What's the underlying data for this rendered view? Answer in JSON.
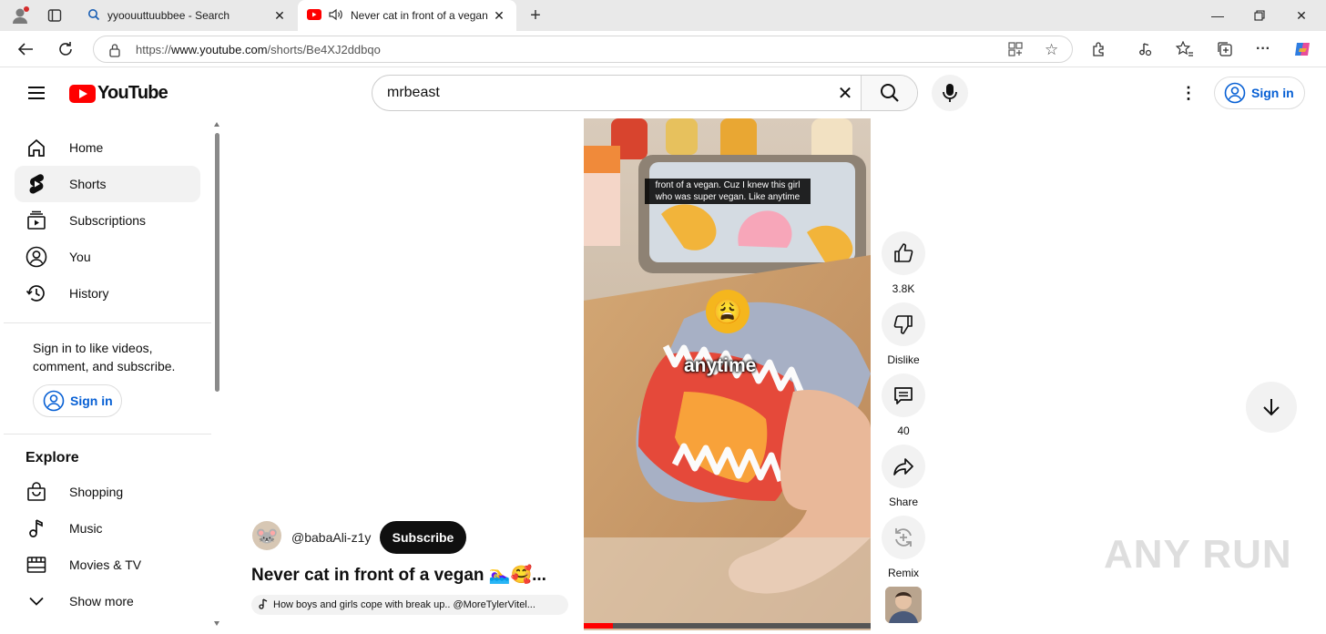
{
  "browser": {
    "tabs": [
      {
        "title": "yyoouuttuubbee - Search",
        "active": false
      },
      {
        "title": "Never cat in front of a vegan",
        "active": true
      }
    ],
    "url_prefix": "https://",
    "url_domain": "www.youtube.com",
    "url_path": "/shorts/Be4XJ2ddbqo"
  },
  "header": {
    "logo_text": "YouTube",
    "search_value": "mrbeast",
    "signin_label": "Sign in"
  },
  "sidebar": {
    "items": [
      {
        "label": "Home",
        "icon": "home-icon"
      },
      {
        "label": "Shorts",
        "icon": "shorts-icon",
        "selected": true
      },
      {
        "label": "Subscriptions",
        "icon": "subscriptions-icon"
      },
      {
        "label": "You",
        "icon": "you-icon"
      },
      {
        "label": "History",
        "icon": "history-icon"
      }
    ],
    "signin_message": "Sign in to like videos, comment, and subscribe.",
    "signin_label": "Sign in",
    "explore_heading": "Explore",
    "explore_items": [
      {
        "label": "Shopping",
        "icon": "shopping-icon"
      },
      {
        "label": "Music",
        "icon": "music-icon"
      },
      {
        "label": "Movies & TV",
        "icon": "movies-icon"
      },
      {
        "label": "Show more",
        "icon": "chevron-down-icon"
      }
    ]
  },
  "video": {
    "caption": "front of a vegan. Cuz I knew this girl who was super vegan. Like anytime",
    "overlay_word": "anytime",
    "progress": 0.1,
    "channel": "@babaAli-z1y",
    "subscribe_label": "Subscribe",
    "title": "Never cat in front of a vegan 🏊‍♀️🥰...",
    "sound": "How boys and girls cope with break up.. @MoreTylerVitel..."
  },
  "actions": [
    {
      "label": "3.8K",
      "icon": "like-icon"
    },
    {
      "label": "Dislike",
      "icon": "dislike-icon"
    },
    {
      "label": "40",
      "icon": "comment-icon"
    },
    {
      "label": "Share",
      "icon": "share-icon"
    },
    {
      "label": "Remix",
      "icon": "remix-icon"
    }
  ],
  "watermark": "ANY RUN"
}
